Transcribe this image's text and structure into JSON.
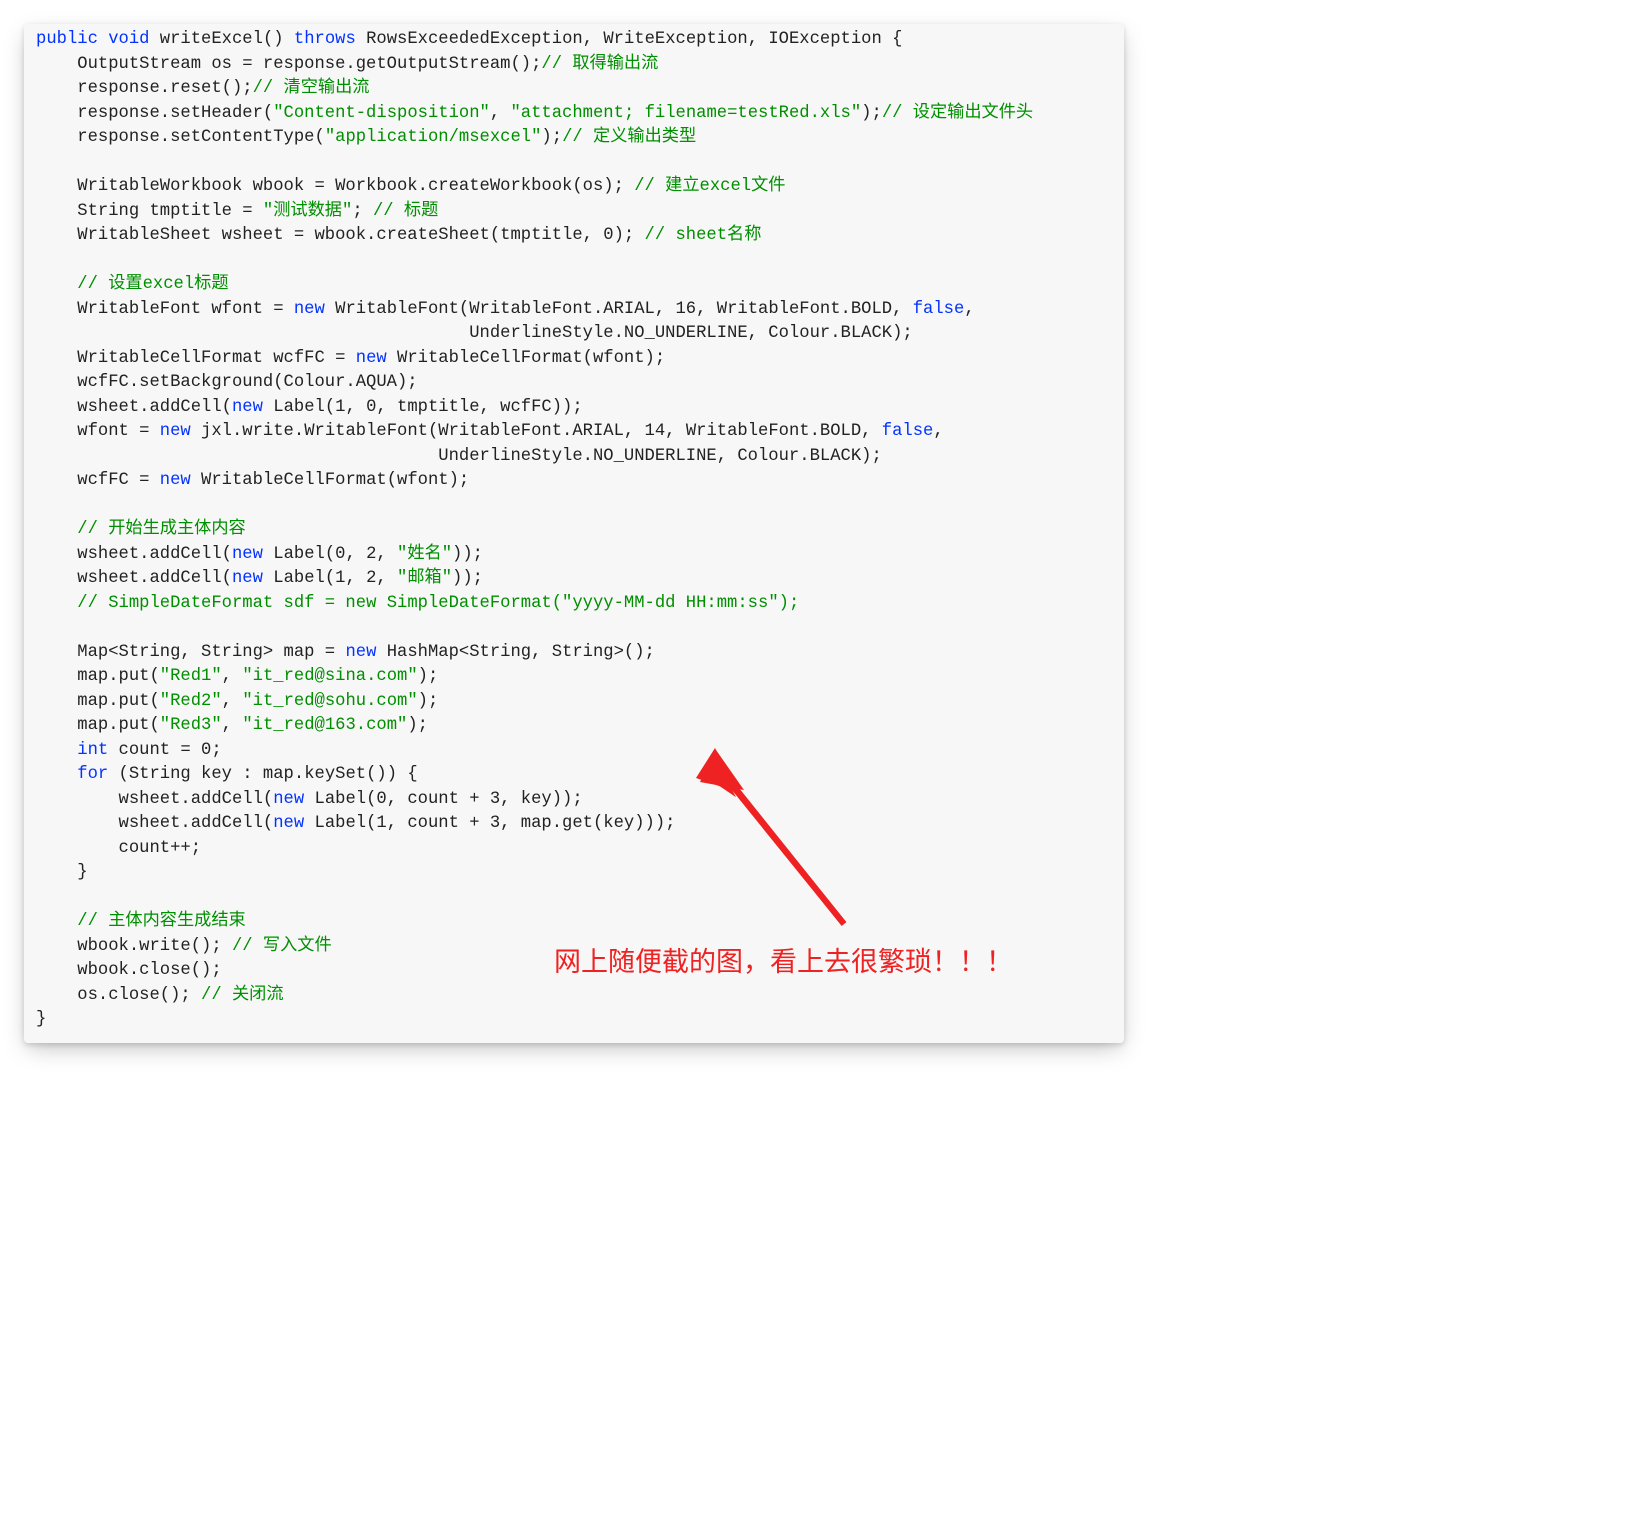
{
  "overlay": {
    "text": "网上随便截的图，看上去很繁琐！！！"
  },
  "code": {
    "lines": [
      [
        {
          "t": "kw",
          "v": "public"
        },
        {
          "t": "p",
          "v": " "
        },
        {
          "t": "kw",
          "v": "void"
        },
        {
          "t": "p",
          "v": " writeExcel() "
        },
        {
          "t": "kw",
          "v": "throws"
        },
        {
          "t": "p",
          "v": " RowsExceededException, WriteException, IOException {"
        }
      ],
      [
        {
          "t": "p",
          "v": "    OutputStream os = response.getOutputStream();"
        },
        {
          "t": "cm",
          "v": "// 取得输出流"
        }
      ],
      [
        {
          "t": "p",
          "v": "    response.reset();"
        },
        {
          "t": "cm",
          "v": "// 清空输出流"
        }
      ],
      [
        {
          "t": "p",
          "v": "    response.setHeader("
        },
        {
          "t": "str",
          "v": "\"Content-disposition\""
        },
        {
          "t": "p",
          "v": ", "
        },
        {
          "t": "str",
          "v": "\"attachment; filename=testRed.xls\""
        },
        {
          "t": "p",
          "v": ");"
        },
        {
          "t": "cm",
          "v": "// 设定输出文件头"
        }
      ],
      [
        {
          "t": "p",
          "v": "    response.setContentType("
        },
        {
          "t": "str",
          "v": "\"application/msexcel\""
        },
        {
          "t": "p",
          "v": ");"
        },
        {
          "t": "cm",
          "v": "// 定义输出类型"
        }
      ],
      [
        {
          "t": "p",
          "v": ""
        }
      ],
      [
        {
          "t": "p",
          "v": "    WritableWorkbook wbook = Workbook.createWorkbook(os); "
        },
        {
          "t": "cm",
          "v": "// 建立excel文件"
        }
      ],
      [
        {
          "t": "p",
          "v": "    String tmptitle = "
        },
        {
          "t": "str",
          "v": "\"测试数据\""
        },
        {
          "t": "p",
          "v": "; "
        },
        {
          "t": "cm",
          "v": "// 标题"
        }
      ],
      [
        {
          "t": "p",
          "v": "    WritableSheet wsheet = wbook.createSheet(tmptitle, 0); "
        },
        {
          "t": "cm",
          "v": "// sheet名称"
        }
      ],
      [
        {
          "t": "p",
          "v": ""
        }
      ],
      [
        {
          "t": "p",
          "v": "    "
        },
        {
          "t": "cm",
          "v": "// 设置excel标题"
        }
      ],
      [
        {
          "t": "p",
          "v": "    WritableFont wfont = "
        },
        {
          "t": "kw",
          "v": "new"
        },
        {
          "t": "p",
          "v": " WritableFont(WritableFont.ARIAL, 16, WritableFont.BOLD, "
        },
        {
          "t": "kw",
          "v": "false"
        },
        {
          "t": "p",
          "v": ","
        }
      ],
      [
        {
          "t": "p",
          "v": "                                          UnderlineStyle.NO_UNDERLINE, Colour.BLACK);"
        }
      ],
      [
        {
          "t": "p",
          "v": "    WritableCellFormat wcfFC = "
        },
        {
          "t": "kw",
          "v": "new"
        },
        {
          "t": "p",
          "v": " WritableCellFormat(wfont);"
        }
      ],
      [
        {
          "t": "p",
          "v": "    wcfFC.setBackground(Colour.AQUA);"
        }
      ],
      [
        {
          "t": "p",
          "v": "    wsheet.addCell("
        },
        {
          "t": "kw",
          "v": "new"
        },
        {
          "t": "p",
          "v": " Label(1, 0, tmptitle, wcfFC));"
        }
      ],
      [
        {
          "t": "p",
          "v": "    wfont = "
        },
        {
          "t": "kw",
          "v": "new"
        },
        {
          "t": "p",
          "v": " jxl.write.WritableFont(WritableFont.ARIAL, 14, WritableFont.BOLD, "
        },
        {
          "t": "kw",
          "v": "false"
        },
        {
          "t": "p",
          "v": ","
        }
      ],
      [
        {
          "t": "p",
          "v": "                                       UnderlineStyle.NO_UNDERLINE, Colour.BLACK);"
        }
      ],
      [
        {
          "t": "p",
          "v": "    wcfFC = "
        },
        {
          "t": "kw",
          "v": "new"
        },
        {
          "t": "p",
          "v": " WritableCellFormat(wfont);"
        }
      ],
      [
        {
          "t": "p",
          "v": ""
        }
      ],
      [
        {
          "t": "p",
          "v": "    "
        },
        {
          "t": "cm",
          "v": "// 开始生成主体内容"
        }
      ],
      [
        {
          "t": "p",
          "v": "    wsheet.addCell("
        },
        {
          "t": "kw",
          "v": "new"
        },
        {
          "t": "p",
          "v": " Label(0, 2, "
        },
        {
          "t": "str",
          "v": "\"姓名\""
        },
        {
          "t": "p",
          "v": "));"
        }
      ],
      [
        {
          "t": "p",
          "v": "    wsheet.addCell("
        },
        {
          "t": "kw",
          "v": "new"
        },
        {
          "t": "p",
          "v": " Label(1, 2, "
        },
        {
          "t": "str",
          "v": "\"邮箱\""
        },
        {
          "t": "p",
          "v": "));"
        }
      ],
      [
        {
          "t": "p",
          "v": "    "
        },
        {
          "t": "cm",
          "v": "// SimpleDateFormat sdf = new SimpleDateFormat(\"yyyy-MM-dd HH:mm:ss\");"
        }
      ],
      [
        {
          "t": "p",
          "v": ""
        }
      ],
      [
        {
          "t": "p",
          "v": "    Map<String, String> map = "
        },
        {
          "t": "kw",
          "v": "new"
        },
        {
          "t": "p",
          "v": " HashMap<String, String>();"
        }
      ],
      [
        {
          "t": "p",
          "v": "    map.put("
        },
        {
          "t": "str",
          "v": "\"Red1\""
        },
        {
          "t": "p",
          "v": ", "
        },
        {
          "t": "str",
          "v": "\"it_red@sina.com\""
        },
        {
          "t": "p",
          "v": ");"
        }
      ],
      [
        {
          "t": "p",
          "v": "    map.put("
        },
        {
          "t": "str",
          "v": "\"Red2\""
        },
        {
          "t": "p",
          "v": ", "
        },
        {
          "t": "str",
          "v": "\"it_red@sohu.com\""
        },
        {
          "t": "p",
          "v": ");"
        }
      ],
      [
        {
          "t": "p",
          "v": "    map.put("
        },
        {
          "t": "str",
          "v": "\"Red3\""
        },
        {
          "t": "p",
          "v": ", "
        },
        {
          "t": "str",
          "v": "\"it_red@163.com\""
        },
        {
          "t": "p",
          "v": ");"
        }
      ],
      [
        {
          "t": "p",
          "v": "    "
        },
        {
          "t": "kw",
          "v": "int"
        },
        {
          "t": "p",
          "v": " count = 0;"
        }
      ],
      [
        {
          "t": "p",
          "v": "    "
        },
        {
          "t": "kw",
          "v": "for"
        },
        {
          "t": "p",
          "v": " (String key : map.keySet()) {"
        }
      ],
      [
        {
          "t": "p",
          "v": "        wsheet.addCell("
        },
        {
          "t": "kw",
          "v": "new"
        },
        {
          "t": "p",
          "v": " Label(0, count + 3, key));"
        }
      ],
      [
        {
          "t": "p",
          "v": "        wsheet.addCell("
        },
        {
          "t": "kw",
          "v": "new"
        },
        {
          "t": "p",
          "v": " Label(1, count + 3, map.get(key)));"
        }
      ],
      [
        {
          "t": "p",
          "v": "        count++;"
        }
      ],
      [
        {
          "t": "p",
          "v": "    }"
        }
      ],
      [
        {
          "t": "p",
          "v": ""
        }
      ],
      [
        {
          "t": "p",
          "v": "    "
        },
        {
          "t": "cm",
          "v": "// 主体内容生成结束"
        }
      ],
      [
        {
          "t": "p",
          "v": "    wbook.write(); "
        },
        {
          "t": "cm",
          "v": "// 写入文件"
        }
      ],
      [
        {
          "t": "p",
          "v": "    wbook.close();"
        }
      ],
      [
        {
          "t": "p",
          "v": "    os.close(); "
        },
        {
          "t": "cm",
          "v": "// 关闭流"
        }
      ],
      [
        {
          "t": "p",
          "v": "}"
        }
      ]
    ]
  }
}
